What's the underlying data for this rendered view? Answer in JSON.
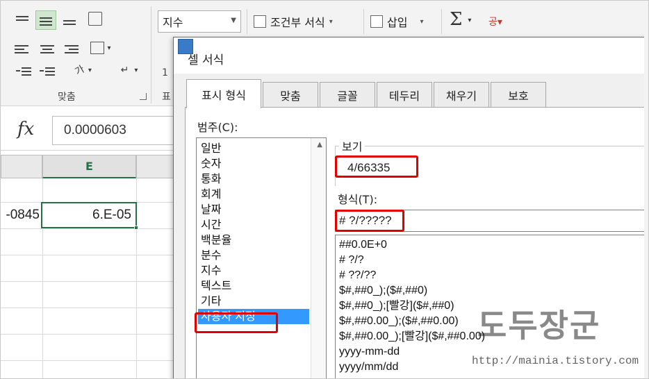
{
  "ribbon": {
    "number_format_value": "지수",
    "conditional_format_label": "조건부 서식",
    "insert_label": "삽입",
    "sum_symbol": "Σ",
    "sort_label": "공▾",
    "align_group_label": "맞춤",
    "cut_char_1": "표",
    "cut_char_2": "1"
  },
  "formula_bar": {
    "fx_label": "fx",
    "value": "0.0000603"
  },
  "sheet": {
    "column_header_e": "E",
    "cell_d_partial": "-0845",
    "cell_e_value": "6.E-05"
  },
  "dialog": {
    "title": "셀 서식",
    "tabs": [
      {
        "label": "표시 형식",
        "active": true
      },
      {
        "label": "맞춤",
        "active": false
      },
      {
        "label": "글꼴",
        "active": false
      },
      {
        "label": "테두리",
        "active": false
      },
      {
        "label": "채우기",
        "active": false
      },
      {
        "label": "보호",
        "active": false
      }
    ],
    "category_label": "범주(C):",
    "categories": [
      "일반",
      "숫자",
      "통화",
      "회계",
      "날짜",
      "시간",
      "백분율",
      "분수",
      "지수",
      "텍스트",
      "기타",
      "사용자 지정"
    ],
    "selected_category": "사용자 지정",
    "sample_label": "보기",
    "sample_value": "4/66335",
    "type_label": "형식(T):",
    "type_value": "# ?/?????",
    "format_codes": [
      "##0.0E+0",
      "# ?/?",
      "# ??/??",
      "$#,##0_);($#,##0)",
      "$#,##0_);[빨강]($#,##0)",
      "$#,##0.00_);($#,##0.00)",
      "$#,##0.00_);[빨강]($#,##0.00)",
      "yyyy-mm-dd",
      "yyyy/mm/dd"
    ]
  },
  "watermark": {
    "text": "도두장군",
    "url": "http://mainia.tistory.com"
  },
  "colors": {
    "excel_green": "#217346",
    "highlight_red": "#e00000",
    "selection_blue": "#3399ff"
  }
}
